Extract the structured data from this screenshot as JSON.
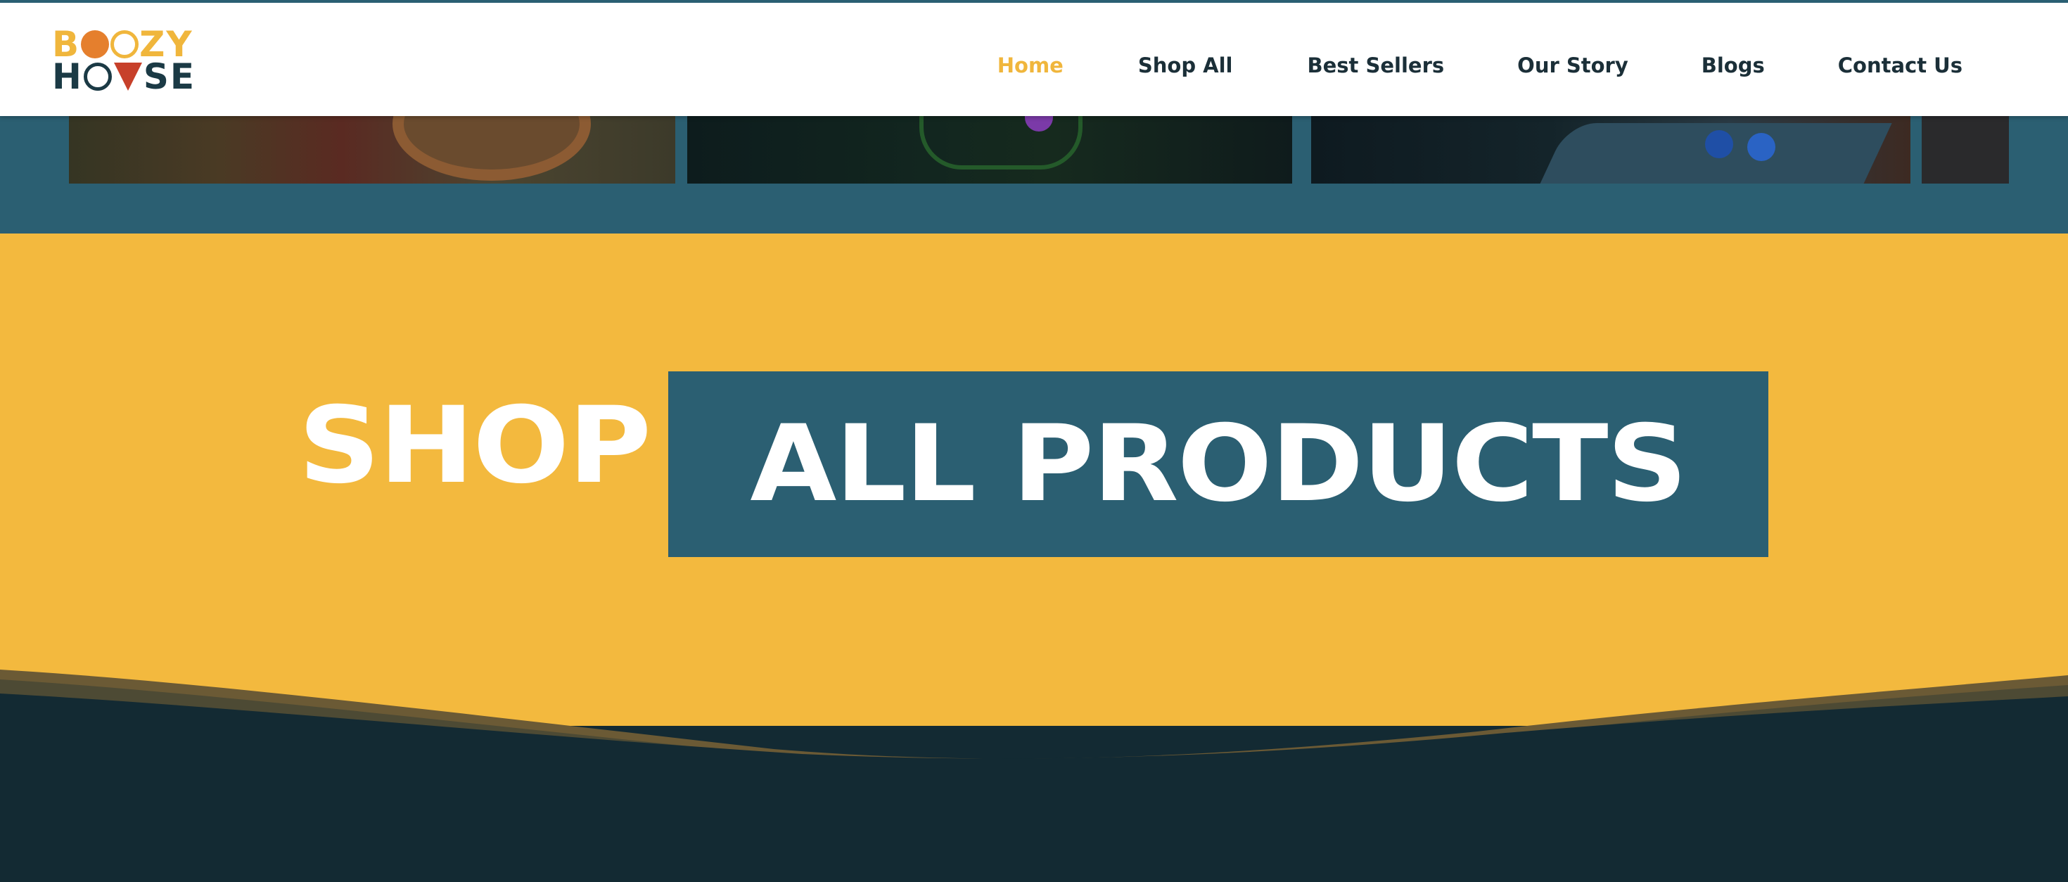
{
  "header": {
    "logo": {
      "line1": [
        "B",
        "ZY"
      ],
      "line2": [
        "H",
        "SE"
      ],
      "alt": "Boozy House"
    },
    "nav": [
      {
        "label": "Home",
        "active": true
      },
      {
        "label": "Shop All",
        "active": false
      },
      {
        "label": "Best Sellers",
        "active": false
      },
      {
        "label": "Our Story",
        "active": false
      },
      {
        "label": "Blogs",
        "active": false
      },
      {
        "label": "Contact Us",
        "active": false
      }
    ]
  },
  "banner": {
    "shop_word": "SHOP",
    "products_word": "ALL PRODUCTS"
  },
  "colors": {
    "accent_yellow": "#f3b93e",
    "teal": "#2b5f72",
    "dark_navy": "#132a33",
    "logo_orange": "#e57f2d",
    "logo_red": "#c7402a"
  }
}
